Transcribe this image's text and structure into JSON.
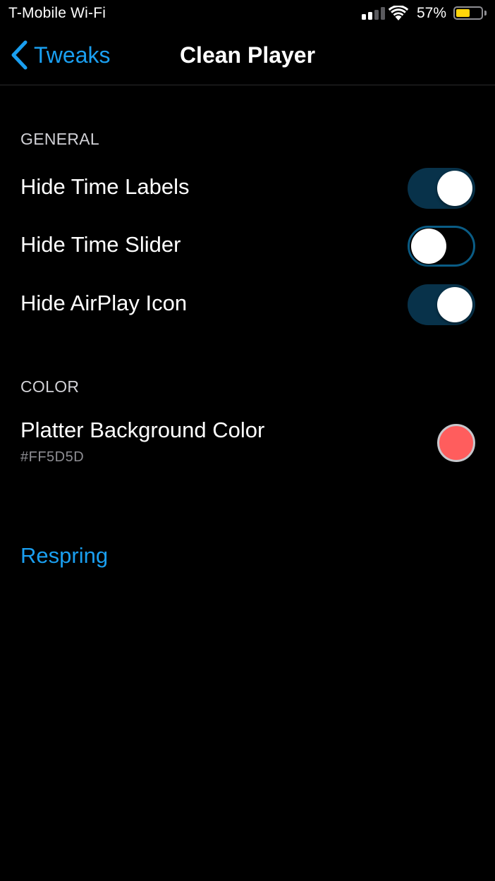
{
  "status_bar": {
    "carrier": "T-Mobile Wi-Fi",
    "battery_percent": "57%",
    "battery_level": 0.57,
    "signal_bars_active": 2,
    "signal_bars_total": 4,
    "battery_color": "#ffd60a"
  },
  "nav": {
    "back_label": "Tweaks",
    "title": "Clean Player",
    "accent_color": "#1a9ff0"
  },
  "sections": {
    "general": {
      "header": "GENERAL",
      "rows": [
        {
          "label": "Hide Time Labels",
          "enabled": true
        },
        {
          "label": "Hide Time Slider",
          "enabled": false
        },
        {
          "label": "Hide AirPlay Icon",
          "enabled": true
        }
      ]
    },
    "color": {
      "header": "COLOR",
      "platter": {
        "label": "Platter Background Color",
        "value": "#FF5D5D",
        "swatch_color": "#ff5d5d"
      }
    }
  },
  "actions": {
    "respring_label": "Respring"
  },
  "icons": {
    "back": "chevron-left-icon",
    "wifi": "wifi-icon",
    "signal": "cellular-signal-icon",
    "battery": "battery-icon"
  }
}
